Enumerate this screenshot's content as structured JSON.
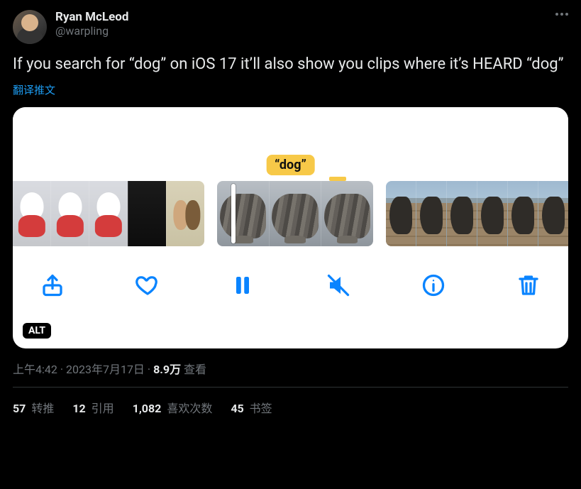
{
  "author": {
    "display_name": "Ryan McLeod",
    "handle": "@warpling"
  },
  "tweet_text": "If you search for “dog” on iOS 17 it’ll also show you clips where it’s HEARD “dog”",
  "translate_label": "翻译推文",
  "media": {
    "caption_chip": "“dog”",
    "alt_badge": "ALT"
  },
  "meta": {
    "time": "上午4:42",
    "date": "2023年7月17日",
    "separator": " · ",
    "views_number": "8.9万",
    "views_label": " 查看"
  },
  "stats": {
    "retweets_num": "57",
    "retweets_label": " 转推",
    "quotes_num": "12",
    "quotes_label": " 引用",
    "likes_num": "1,082",
    "likes_label": " 喜欢次数",
    "bookmarks_num": "45",
    "bookmarks_label": " 书签"
  }
}
